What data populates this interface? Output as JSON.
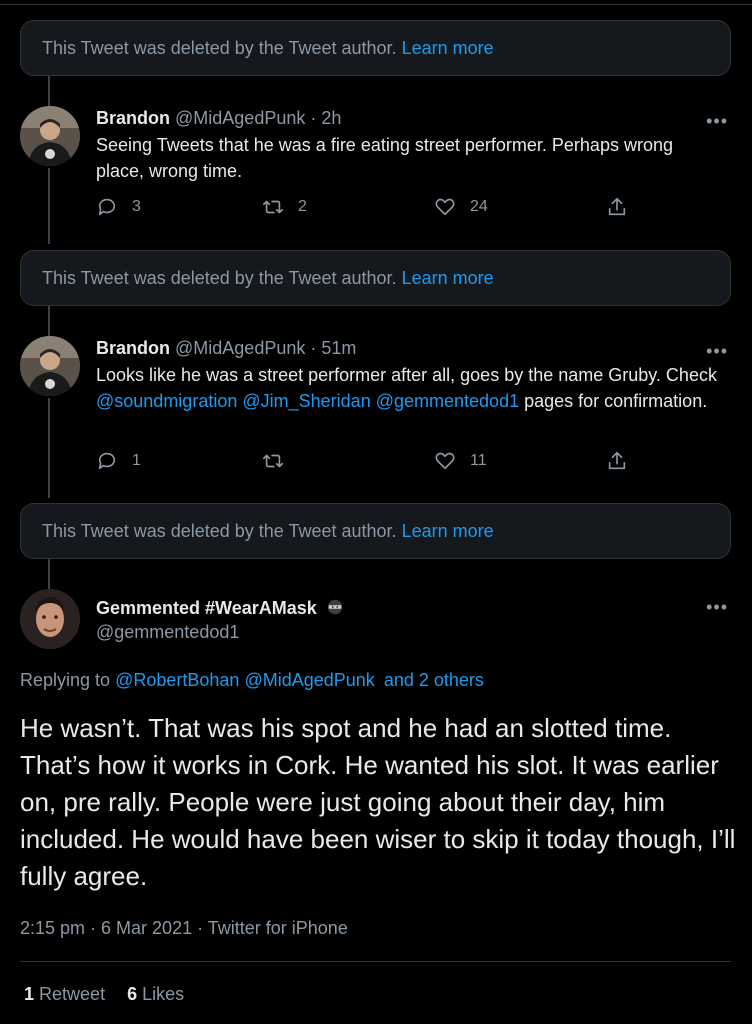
{
  "deleted": {
    "text": "This Tweet was deleted by the Tweet author.",
    "link": "Learn more"
  },
  "tweet1": {
    "name": "Brandon",
    "handle": "@MidAgedPunk",
    "time": "· 2h",
    "text": "Seeing Tweets that he was a fire eating street performer. Perhaps wrong place, wrong time.",
    "reply_count": "3",
    "retweet_count": "2",
    "like_count": "24"
  },
  "tweet2": {
    "name": "Brandon",
    "handle": "@MidAgedPunk",
    "time": "· 51m",
    "text_a": "Looks like he was a street performer after all, goes by the name Gruby. Check",
    "mention1": "@soundmigration",
    "mention2": "@Jim_Sheridan",
    "mention3": "@gemmentedod1",
    "text_b": "pages for confirmation.",
    "reply_count": "1",
    "retweet_count": "",
    "like_count": "11"
  },
  "main": {
    "name": "Gemmented #WearAMask",
    "handle": "@gemmentedod1",
    "replying_prefix": "Replying to",
    "replying_m1": "@RobertBohan",
    "replying_m2": "@MidAgedPunk",
    "replying_others": "and 2 others",
    "text": "He wasn’t. That was his spot and he had an slotted time. That’s how it works in Cork. He wanted his slot. It was earlier on, pre rally. People were just going about their day, him included. He would have been wiser to skip it today though, I’ll fully agree.",
    "timestamp": "2:15 pm · 6 Mar 2021 · Twitter for iPhone",
    "retweets_count": "1",
    "retweets_label": "Retweet",
    "likes_count": "6",
    "likes_label": "Likes"
  },
  "more_label": "•••",
  "colors": {
    "background": "#000000",
    "link": "#1d9bf0",
    "muted": "#8b98a5",
    "text": "#e7e9ea"
  },
  "icons": [
    "reply-icon",
    "retweet-icon",
    "like-icon",
    "share-icon",
    "ninja-emoji-icon",
    "more-icon"
  ]
}
